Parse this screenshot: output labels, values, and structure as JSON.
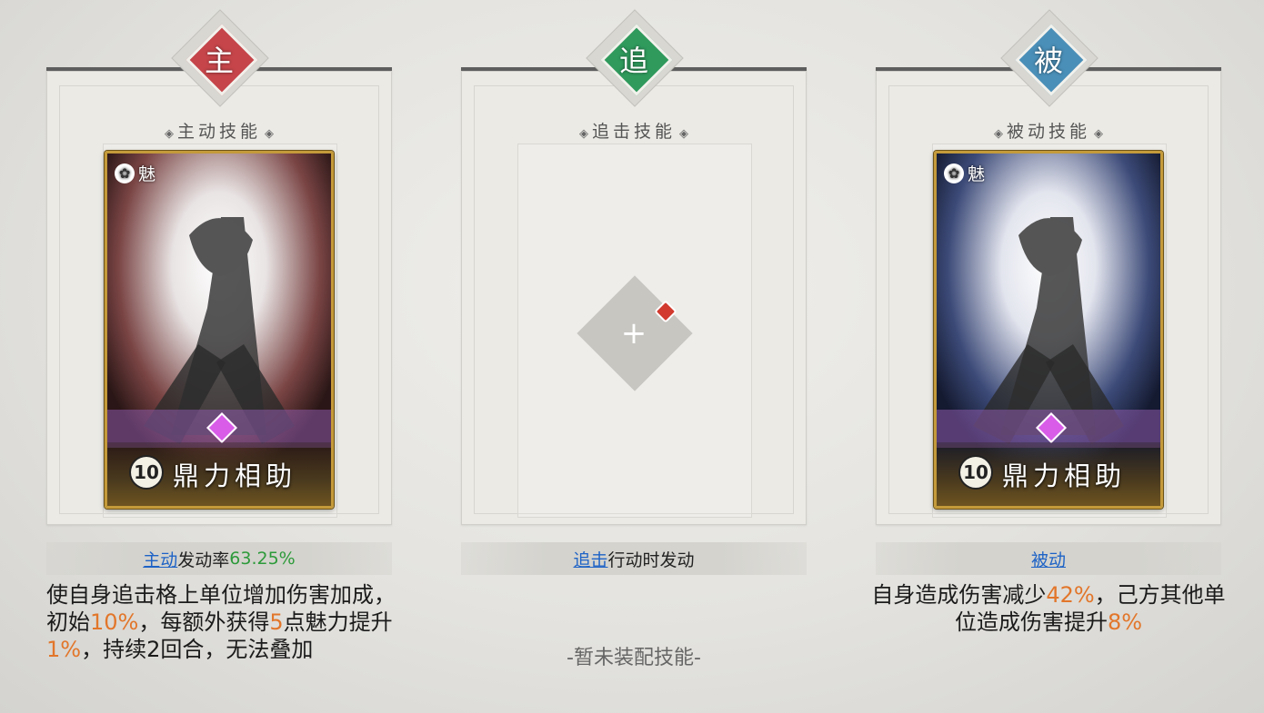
{
  "active": {
    "emblem_char": "主",
    "emblem_color": "#c5454a",
    "title": "主动技能",
    "card": {
      "tag_icon": "✿",
      "tag": "魅",
      "level": "10",
      "name": "鼎力相助",
      "art_color": "#7a4444"
    },
    "trigger_keyword": "主动",
    "trigger_text": "发动率",
    "trigger_rate": "63.25%",
    "desc": {
      "p1": "使自身追击格上单位增加伤害加成，初始",
      "v1": "10%",
      "p2": "，每额外获得",
      "v2": "5",
      "p3": "点魅力提升",
      "v3": "1%",
      "p4": "，持续2回合，无法叠加"
    }
  },
  "pursuit": {
    "emblem_char": "追",
    "emblem_color": "#2f9a5c",
    "title": "追击技能",
    "plus": "+",
    "trigger_keyword": "追击",
    "trigger_text": "行动时发动",
    "empty_text": "-暂未装配技能-"
  },
  "passive": {
    "emblem_char": "被",
    "emblem_color": "#4a8fb8",
    "title": "被动技能",
    "card": {
      "tag_icon": "✿",
      "tag": "魅",
      "level": "10",
      "name": "鼎力相助",
      "art_color": "#3c4a78"
    },
    "trigger_keyword": "被动",
    "desc": {
      "p1": "自身造成伤害减少",
      "v1": "42%",
      "p2": "，己方其他单位造成伤害提升",
      "v2": "8%"
    }
  }
}
